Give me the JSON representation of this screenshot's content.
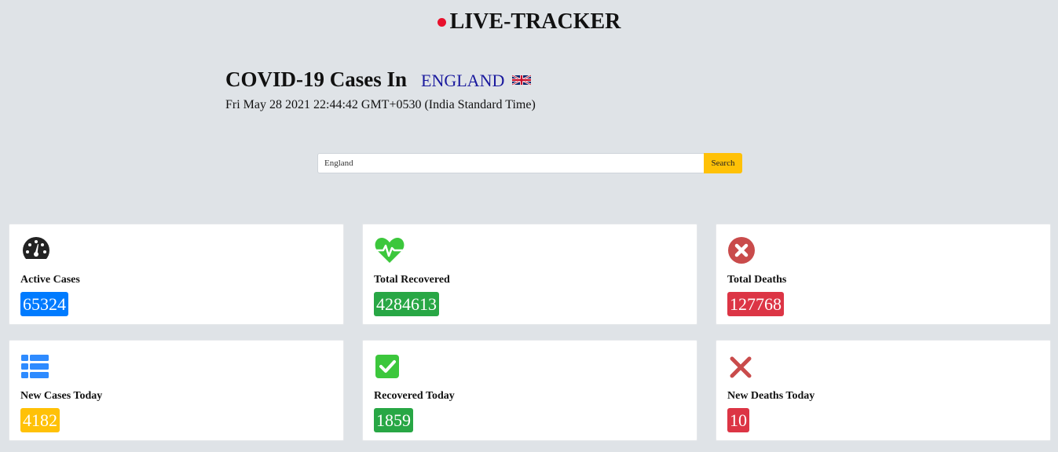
{
  "brand": {
    "title": "LIVE-TRACKER"
  },
  "header": {
    "title": "COVID-19 Cases In",
    "country": "ENGLAND",
    "timestamp": "Fri May 28 2021 22:44:42 GMT+0530 (India Standard Time)"
  },
  "search": {
    "value": "England",
    "button_label": "Search"
  },
  "colors": {
    "blue": "#007bff",
    "green": "#28a745",
    "red": "#dc3545",
    "yellow": "#ffc107",
    "live_dot": "#e8112d"
  },
  "stats": {
    "active": {
      "label": "Active Cases",
      "value": "65324",
      "icon": "speedometer-icon"
    },
    "recovered": {
      "label": "Total Recovered",
      "value": "4284613",
      "icon": "heartbeat-icon"
    },
    "deaths": {
      "label": "Total Deaths",
      "value": "127768",
      "icon": "times-circle-icon"
    },
    "new_cases": {
      "label": "New Cases Today",
      "value": "4182",
      "icon": "list-icon"
    },
    "recovered_today": {
      "label": "Recovered Today",
      "value": "1859",
      "icon": "check-square-icon"
    },
    "new_deaths": {
      "label": "New Deaths Today",
      "value": "10",
      "icon": "times-icon"
    }
  }
}
